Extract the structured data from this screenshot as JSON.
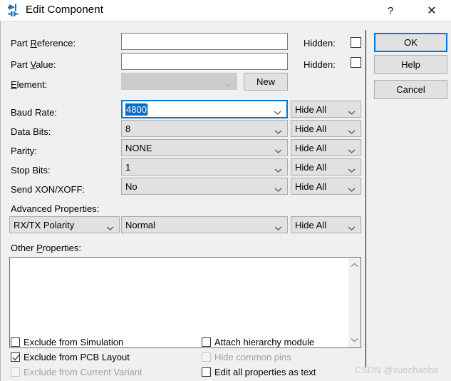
{
  "window": {
    "title": "Edit Component",
    "icon": "component-icon",
    "help_label": "?",
    "close_label": "✕"
  },
  "fields": {
    "part_reference": {
      "label_pre": "Part ",
      "label_mnemonic": "R",
      "label_post": "eference:",
      "value": "",
      "hidden_label": "Hidden:",
      "hidden_checked": false
    },
    "part_value": {
      "label_pre": "Part ",
      "label_mnemonic": "V",
      "label_post": "alue:",
      "value": "",
      "hidden_label": "Hidden:",
      "hidden_checked": false
    },
    "element": {
      "label_pre": "",
      "label_mnemonic": "E",
      "label_post": "lement:",
      "value": "",
      "disabled": true,
      "new_button": "New"
    }
  },
  "property_rows": [
    {
      "label": "Baud Rate:",
      "value": "4800",
      "visibility": "Hide All",
      "focused": true
    },
    {
      "label": "Data Bits:",
      "value": "8",
      "visibility": "Hide All",
      "focused": false
    },
    {
      "label": "Parity:",
      "value": "NONE",
      "visibility": "Hide All",
      "focused": false
    },
    {
      "label": "Stop Bits:",
      "value": "1",
      "visibility": "Hide All",
      "focused": false
    },
    {
      "label": "Send XON/XOFF:",
      "value": "No",
      "visibility": "Hide All",
      "focused": false
    }
  ],
  "advanced": {
    "label": "Advanced Properties:",
    "property_name": "RX/TX Polarity",
    "property_value": "Normal",
    "visibility": "Hide All"
  },
  "other_properties": {
    "label_pre": "Other ",
    "label_mnemonic": "P",
    "label_post": "roperties:",
    "value": ""
  },
  "checkboxes_left": [
    {
      "label": "Exclude from Simulation",
      "checked": false,
      "disabled": false
    },
    {
      "label": "Exclude from PCB Layout",
      "checked": true,
      "disabled": false
    },
    {
      "label": "Exclude from Current Variant",
      "checked": false,
      "disabled": true
    }
  ],
  "checkboxes_right": [
    {
      "label": "Attach hierarchy module",
      "checked": false,
      "disabled": false
    },
    {
      "label": "Hide common pins",
      "checked": false,
      "disabled": true
    },
    {
      "label": "Edit all properties as text",
      "checked": false,
      "disabled": false
    }
  ],
  "buttons": {
    "ok": "OK",
    "help": "Help",
    "cancel": "Cancel"
  },
  "watermark": "CSDN @xuechanba",
  "colors": {
    "accent": "#0078d7",
    "selection": "#0b6cc4",
    "dialog_bg": "#f0f0f0",
    "control_bg": "#e1e1e1",
    "caret": "#d98b45"
  }
}
